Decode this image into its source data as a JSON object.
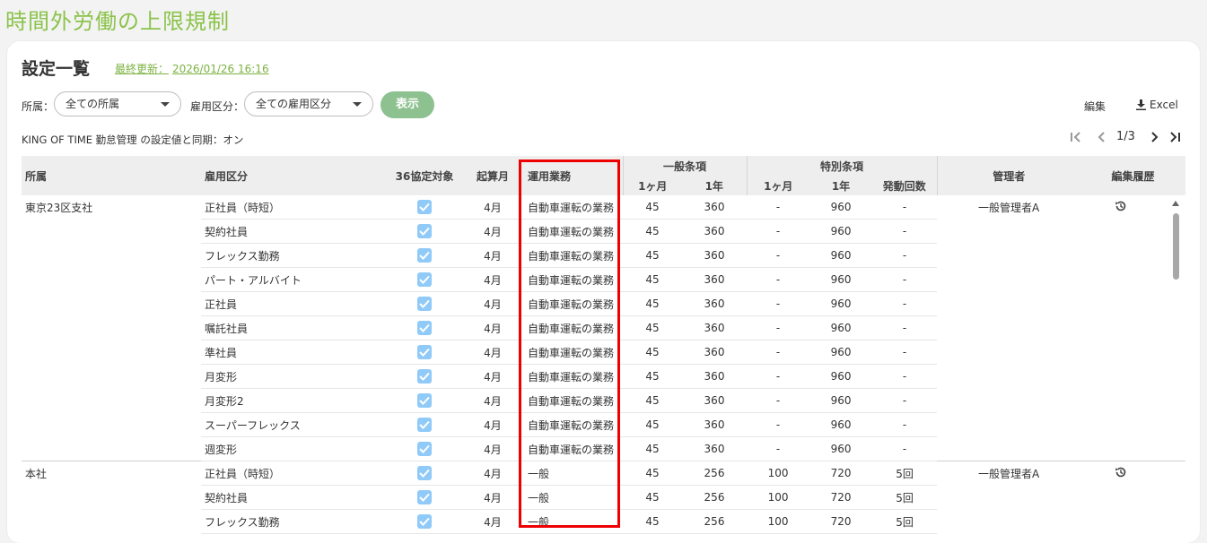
{
  "app": {
    "title": "時間外労働の上限規制"
  },
  "header": {
    "page_title": "設定一覧",
    "updated_label": "最終更新：",
    "updated_value": "2026/01/26 16:16"
  },
  "filters": {
    "dept_label": "所属：",
    "dept_value": "全ての所属",
    "type_label": "雇用区分：",
    "type_value": "全ての雇用区分",
    "show_label": "表示"
  },
  "actions": {
    "edit_label": "編集",
    "excel_label": "Excel"
  },
  "sync_text": "KING OF TIME 勤怠管理 の設定値と同期：オン",
  "pager": {
    "text": "1/3"
  },
  "table": {
    "headers": {
      "dept": "所属",
      "type": "雇用区分",
      "agreement": "36協定対象",
      "start": "起算月",
      "work": "運用業務",
      "general": "一般条項",
      "special": "特別条項",
      "month": "1ヶ月",
      "year": "1年",
      "count": "発動回数",
      "manager": "管理者",
      "history": "編集履歴"
    },
    "rows": [
      {
        "dept": "東京23区支社",
        "type": "正社員（時短）",
        "start": "4月",
        "work": "自動車運転の業務",
        "g_month": "45",
        "g_year": "360",
        "s_month": "-",
        "s_year": "960",
        "s_count": "-",
        "manager": "一般管理者A"
      },
      {
        "dept": "",
        "type": "契約社員",
        "start": "4月",
        "work": "自動車運転の業務",
        "g_month": "45",
        "g_year": "360",
        "s_month": "-",
        "s_year": "960",
        "s_count": "-",
        "manager": ""
      },
      {
        "dept": "",
        "type": "フレックス勤務",
        "start": "4月",
        "work": "自動車運転の業務",
        "g_month": "45",
        "g_year": "360",
        "s_month": "-",
        "s_year": "960",
        "s_count": "-",
        "manager": ""
      },
      {
        "dept": "",
        "type": "パート・アルバイト",
        "start": "4月",
        "work": "自動車運転の業務",
        "g_month": "45",
        "g_year": "360",
        "s_month": "-",
        "s_year": "960",
        "s_count": "-",
        "manager": ""
      },
      {
        "dept": "",
        "type": "正社員",
        "start": "4月",
        "work": "自動車運転の業務",
        "g_month": "45",
        "g_year": "360",
        "s_month": "-",
        "s_year": "960",
        "s_count": "-",
        "manager": ""
      },
      {
        "dept": "",
        "type": "嘱託社員",
        "start": "4月",
        "work": "自動車運転の業務",
        "g_month": "45",
        "g_year": "360",
        "s_month": "-",
        "s_year": "960",
        "s_count": "-",
        "manager": ""
      },
      {
        "dept": "",
        "type": "準社員",
        "start": "4月",
        "work": "自動車運転の業務",
        "g_month": "45",
        "g_year": "360",
        "s_month": "-",
        "s_year": "960",
        "s_count": "-",
        "manager": ""
      },
      {
        "dept": "",
        "type": "月変形",
        "start": "4月",
        "work": "自動車運転の業務",
        "g_month": "45",
        "g_year": "360",
        "s_month": "-",
        "s_year": "960",
        "s_count": "-",
        "manager": ""
      },
      {
        "dept": "",
        "type": "月変形2",
        "start": "4月",
        "work": "自動車運転の業務",
        "g_month": "45",
        "g_year": "360",
        "s_month": "-",
        "s_year": "960",
        "s_count": "-",
        "manager": ""
      },
      {
        "dept": "",
        "type": "スーパーフレックス",
        "start": "4月",
        "work": "自動車運転の業務",
        "g_month": "45",
        "g_year": "360",
        "s_month": "-",
        "s_year": "960",
        "s_count": "-",
        "manager": ""
      },
      {
        "dept": "",
        "type": "週変形",
        "start": "4月",
        "work": "自動車運転の業務",
        "g_month": "45",
        "g_year": "360",
        "s_month": "-",
        "s_year": "960",
        "s_count": "-",
        "manager": ""
      },
      {
        "dept": "本社",
        "type": "正社員（時短）",
        "start": "4月",
        "work": "一般",
        "g_month": "45",
        "g_year": "256",
        "s_month": "100",
        "s_year": "720",
        "s_count": "5回",
        "manager": "一般管理者A"
      },
      {
        "dept": "",
        "type": "契約社員",
        "start": "4月",
        "work": "一般",
        "g_month": "45",
        "g_year": "256",
        "s_month": "100",
        "s_year": "720",
        "s_count": "5回",
        "manager": ""
      },
      {
        "dept": "",
        "type": "フレックス勤務",
        "start": "4月",
        "work": "一般",
        "g_month": "45",
        "g_year": "256",
        "s_month": "100",
        "s_year": "720",
        "s_count": "5回",
        "manager": ""
      }
    ]
  },
  "icons": {
    "history": "history-icon",
    "checkbox": "checkbox-checked-icon",
    "download": "download-icon"
  },
  "colors": {
    "accent": "#8bc34a",
    "button": "#8dc18f",
    "checkbox": "#90caf9",
    "highlight": "#e00000"
  }
}
